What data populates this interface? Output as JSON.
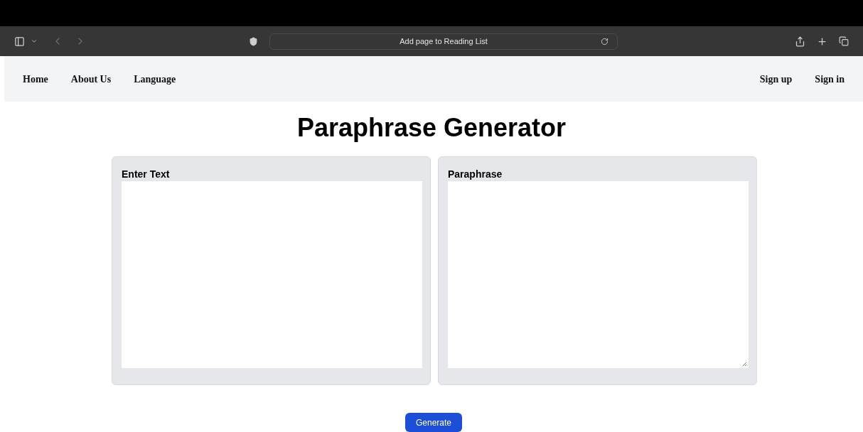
{
  "browser": {
    "address": "Add page to Reading List"
  },
  "nav": {
    "left": [
      "Home",
      "About Us",
      "Language"
    ],
    "right": [
      "Sign up",
      "Sign in"
    ]
  },
  "title": "Paraphrase Generator",
  "panels": [
    {
      "label": "Enter Text",
      "resizable": false
    },
    {
      "label": "Paraphrase",
      "resizable": true
    }
  ],
  "button": "Generate"
}
